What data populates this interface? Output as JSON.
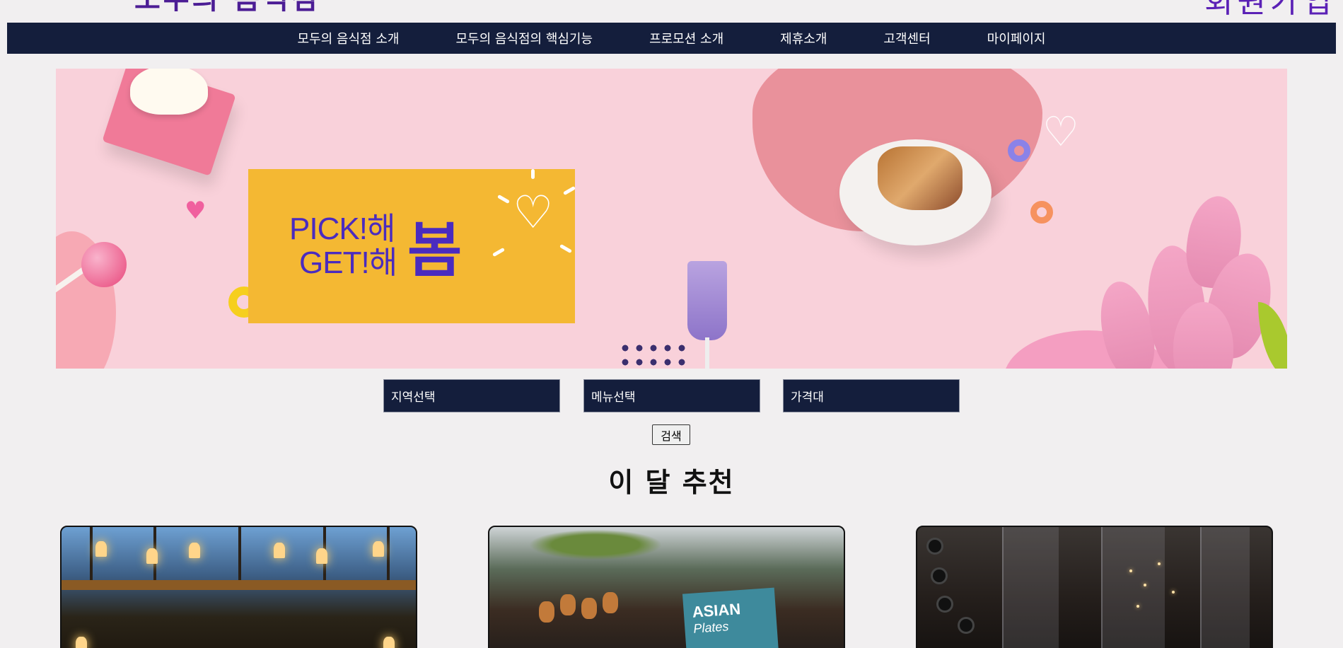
{
  "header": {
    "logo_text": "모두의 음식점",
    "signup_text": "회원가입"
  },
  "nav": {
    "items": [
      {
        "label": "모두의 음식점 소개"
      },
      {
        "label": "모두의 음식점의 핵심기능"
      },
      {
        "label": "프로모션 소개"
      },
      {
        "label": "제휴소개"
      },
      {
        "label": "고객센터"
      },
      {
        "label": "마이페이지"
      }
    ]
  },
  "hero": {
    "line1": "PICK!해",
    "line2": "GET!해",
    "big": "봄",
    "heart_glyph": "♡",
    "accent_color": "#4a2bbf",
    "box_color": "#f4b833",
    "background_color": "#f9d1da"
  },
  "search": {
    "region_label": "지역선택",
    "menu_label": "메뉴선택",
    "price_label": "가격대",
    "button_label": "검색"
  },
  "recommend": {
    "title": "이 달 추천",
    "asian_sign_line1": "ASIAN",
    "asian_sign_line2": "Plates"
  },
  "colors": {
    "navbar": "#141e3c",
    "page_bg": "#f1eff0",
    "brand_purple": "#4c1d95"
  }
}
